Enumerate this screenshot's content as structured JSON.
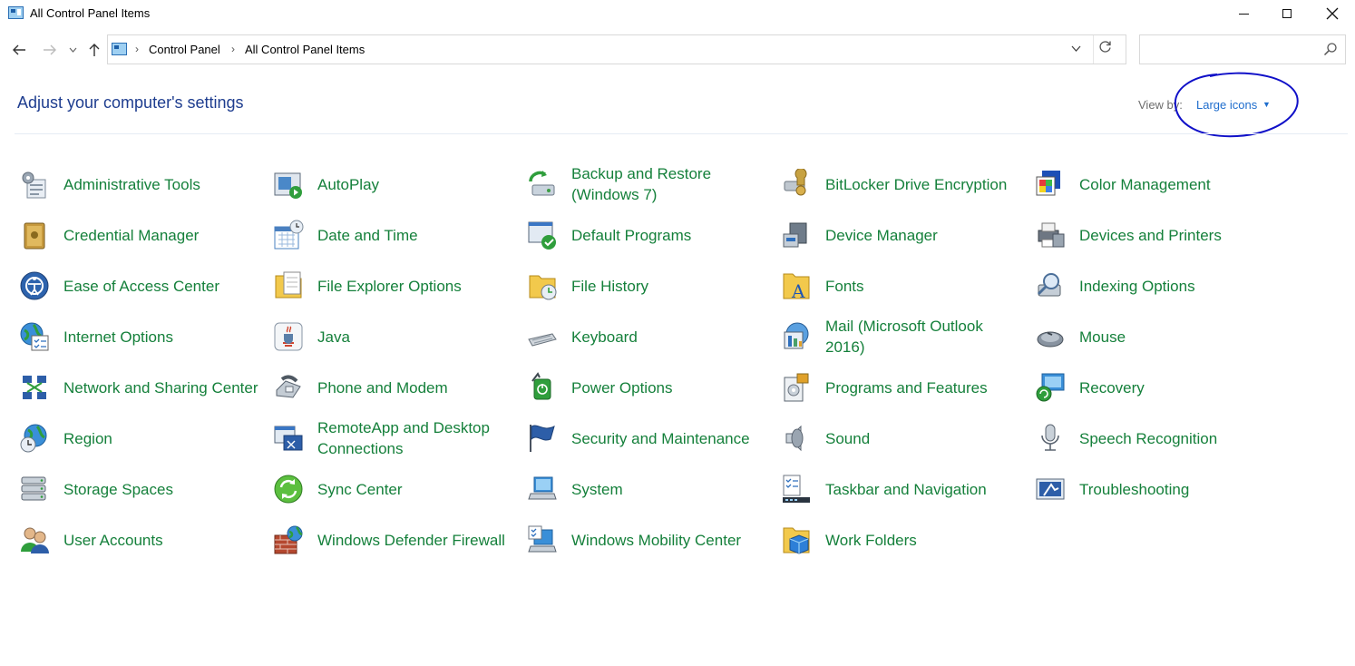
{
  "window": {
    "title": "All Control Panel Items",
    "controls": [
      "minimize",
      "maximize",
      "close"
    ]
  },
  "address": {
    "crumbs": [
      "Control Panel",
      "All Control Panel Items"
    ],
    "search_placeholder": ""
  },
  "header": {
    "heading": "Adjust your computer's settings",
    "view_by_label": "View by:",
    "view_by_value": "Large icons",
    "annotation": "blue hand-drawn circle around view selector"
  },
  "items": [
    {
      "label": "Administrative Tools",
      "icon": "tools-icon"
    },
    {
      "label": "AutoPlay",
      "icon": "autoplay-icon"
    },
    {
      "label": "Backup and Restore (Windows 7)",
      "icon": "backup-icon"
    },
    {
      "label": "BitLocker Drive Encryption",
      "icon": "bitlocker-icon"
    },
    {
      "label": "Color Management",
      "icon": "color-management-icon"
    },
    {
      "label": "Credential Manager",
      "icon": "credential-icon"
    },
    {
      "label": "Date and Time",
      "icon": "calendar-clock-icon"
    },
    {
      "label": "Default Programs",
      "icon": "default-programs-icon"
    },
    {
      "label": "Device Manager",
      "icon": "device-manager-icon"
    },
    {
      "label": "Devices and Printers",
      "icon": "printer-icon"
    },
    {
      "label": "Ease of Access Center",
      "icon": "ease-of-access-icon"
    },
    {
      "label": "File Explorer Options",
      "icon": "folder-options-icon"
    },
    {
      "label": "File History",
      "icon": "file-history-icon"
    },
    {
      "label": "Fonts",
      "icon": "fonts-icon"
    },
    {
      "label": "Indexing Options",
      "icon": "indexing-icon"
    },
    {
      "label": "Internet Options",
      "icon": "internet-options-icon"
    },
    {
      "label": "Java",
      "icon": "java-icon"
    },
    {
      "label": "Keyboard",
      "icon": "keyboard-icon"
    },
    {
      "label": "Mail (Microsoft Outlook 2016)",
      "icon": "mail-icon"
    },
    {
      "label": "Mouse",
      "icon": "mouse-icon"
    },
    {
      "label": "Network and Sharing Center",
      "icon": "network-icon"
    },
    {
      "label": "Phone and Modem",
      "icon": "phone-icon"
    },
    {
      "label": "Power Options",
      "icon": "power-icon"
    },
    {
      "label": "Programs and Features",
      "icon": "programs-icon"
    },
    {
      "label": "Recovery",
      "icon": "recovery-icon"
    },
    {
      "label": "Region",
      "icon": "globe-clock-icon"
    },
    {
      "label": "RemoteApp and Desktop Connections",
      "icon": "remoteapp-icon"
    },
    {
      "label": "Security and Maintenance",
      "icon": "flag-icon"
    },
    {
      "label": "Sound",
      "icon": "speaker-icon"
    },
    {
      "label": "Speech Recognition",
      "icon": "microphone-icon"
    },
    {
      "label": "Storage Spaces",
      "icon": "storage-icon"
    },
    {
      "label": "Sync Center",
      "icon": "sync-icon"
    },
    {
      "label": "System",
      "icon": "system-icon"
    },
    {
      "label": "Taskbar and Navigation",
      "icon": "taskbar-icon"
    },
    {
      "label": "Troubleshooting",
      "icon": "troubleshooting-icon"
    },
    {
      "label": "User Accounts",
      "icon": "users-icon"
    },
    {
      "label": "Windows Defender Firewall",
      "icon": "firewall-icon"
    },
    {
      "label": "Windows Mobility Center",
      "icon": "mobility-icon"
    },
    {
      "label": "Work Folders",
      "icon": "work-folders-icon"
    }
  ],
  "colors": {
    "link_green": "#15803b",
    "heading_blue": "#1e3d8f",
    "annotation_blue": "#1010c8"
  }
}
